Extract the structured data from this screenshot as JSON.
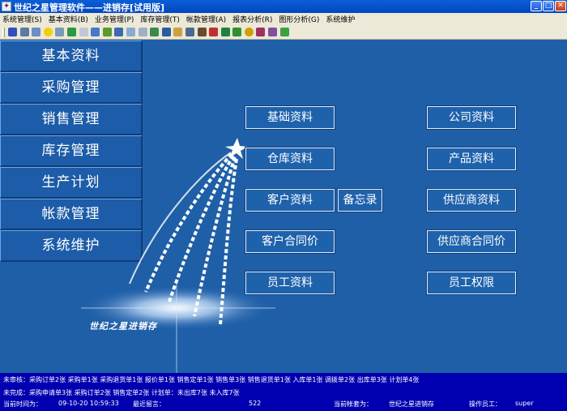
{
  "window": {
    "title": "世纪之星管理软件——进销存[试用版]"
  },
  "menu": [
    "系统管理(S)",
    "基本资料(B)",
    "业务管理(P)",
    "库存管理(T)",
    "帐款管理(A)",
    "报表分析(R)",
    "图形分析(G)",
    "系统维护"
  ],
  "toolbar_icons": [
    "user-icon",
    "table-icon",
    "book-icon",
    "smiley-icon",
    "grid-icon",
    "check-icon",
    "document-icon",
    "pen-icon",
    "arrow-icon",
    "tools-icon",
    "copy-icon",
    "box-icon",
    "transfer-icon",
    "tag-icon",
    "folder-icon",
    "chart-icon",
    "person-icon",
    "truck-icon",
    "shield-icon",
    "money-icon",
    "coin-icon",
    "stamp-icon",
    "book2-icon",
    "exit-icon"
  ],
  "nav": [
    "基本资料",
    "采购管理",
    "销售管理",
    "库存管理",
    "生产计划",
    "帐款管理",
    "系统维护"
  ],
  "buttons": {
    "base_data": "基础资料",
    "company_data": "公司资料",
    "warehouse_data": "仓库资料",
    "product_data": "产品资料",
    "customer_data": "客户资料",
    "memo": "备忘录",
    "supplier_data": "供应商资料",
    "customer_contract_price": "客户合同价",
    "supplier_contract_price": "供应商合同价",
    "employee_data": "员工资料",
    "employee_rights": "员工权限"
  },
  "logo_text": "世纪之星进销存",
  "status": {
    "unreviewed": "未审核：采购订单2张 采购单1张 采购退货单1张 报价单1张 销售定单1张 销售单3张 销售退货单1张 入库单1张 调拨单2张 出库单3张 计划单4张",
    "unfinished": "未完成：采购申请单3张 采购订单2张 销售定单2张 计划单：未出库7张 未入库7张",
    "time_label": "当前时间为：",
    "time_value": "09-10-20 10:59:33",
    "message_label": "最近留言：",
    "message_value": "522",
    "account_label": "当前帐套为：",
    "account_value": "世纪之星进销存",
    "operator_label": "操作员工：",
    "operator_value": "super"
  }
}
